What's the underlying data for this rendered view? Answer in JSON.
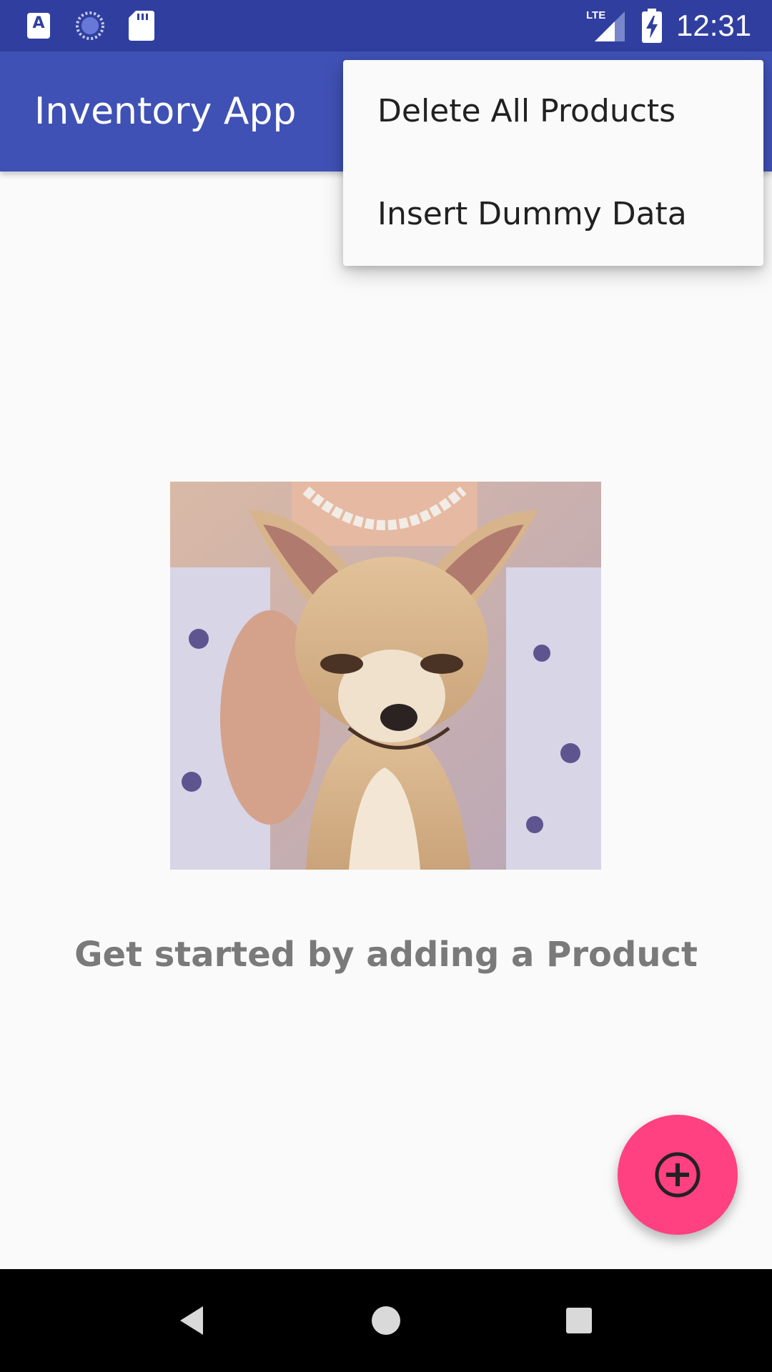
{
  "status_bar": {
    "time": "12:31",
    "network_label": "LTE",
    "notification_app_letter": "A",
    "icons": [
      "app-a-icon",
      "loading-icon",
      "sd-card-icon",
      "lte-signal-icon",
      "battery-charging-icon"
    ]
  },
  "toolbar": {
    "title": "Inventory App"
  },
  "overflow_menu": {
    "items": [
      {
        "label": "Delete All Products"
      },
      {
        "label": "Insert Dummy Data"
      }
    ]
  },
  "empty_state": {
    "image": "chihuahua-photo",
    "message": "Get started by adding a Product"
  },
  "fab": {
    "icon": "add-circle-icon"
  },
  "navigation_bar": {
    "icons": [
      "back-icon",
      "home-icon",
      "recents-icon"
    ]
  },
  "colors": {
    "status_bar": "#303f9f",
    "toolbar": "#3f51b5",
    "fab": "#ff4081",
    "background": "#fafafa",
    "empty_text": "#7a7a7a"
  }
}
